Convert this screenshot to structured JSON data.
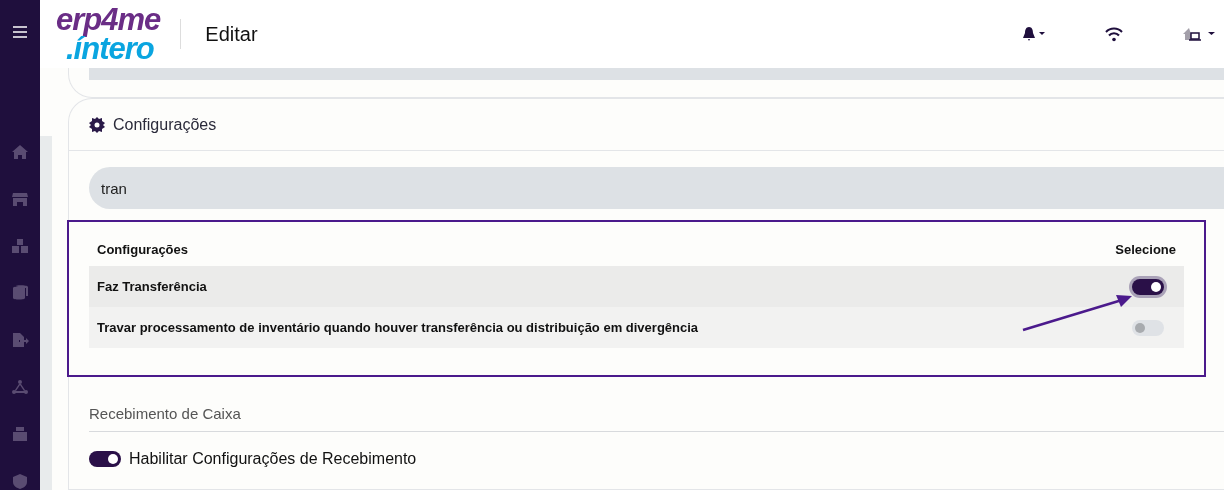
{
  "header": {
    "logo_top": "erp4me",
    "logo_bottom": ".íntero",
    "title": "Editar"
  },
  "card": {
    "title": "Configurações",
    "search": {
      "value": "tran"
    },
    "table": {
      "columns": [
        "Configurações",
        "Selecione"
      ],
      "rows": [
        {
          "label": "Faz Transferência",
          "on": true,
          "focused": true
        },
        {
          "label": "Travar processamento de inventário quando houver transferência ou distribuição em divergência",
          "on": false,
          "focused": false
        }
      ]
    }
  },
  "section": {
    "title": "Recebimento de Caixa",
    "toggle": {
      "label": "Habilitar Configurações de Recebimento",
      "on": true
    }
  }
}
